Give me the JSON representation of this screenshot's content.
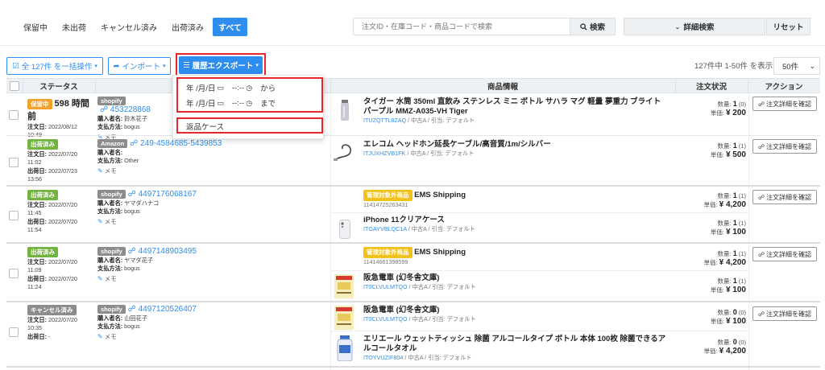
{
  "filters": {
    "tabs": [
      {
        "label": "保留中",
        "active": false
      },
      {
        "label": "未出荷",
        "active": false
      },
      {
        "label": "キャンセル済み",
        "active": false
      },
      {
        "label": "出荷済み",
        "active": false
      },
      {
        "label": "すべて",
        "active": true
      }
    ],
    "search_placeholder": "注文ID・在庫コード・商品コードで検索",
    "search_button": "検索",
    "advanced_search": "詳細検索",
    "reset": "リセット"
  },
  "toolbar": {
    "bulk_action": "全 127件 を一括操作",
    "import": "インポート",
    "export": "履歴エクスポート",
    "page_info": "127件中 1-50件 を表示",
    "page_size": "50件"
  },
  "export_dropdown": {
    "date_placeholder": "年 /月/日",
    "time_placeholder": "--:--",
    "from_label": "から",
    "to_label": "まで",
    "returns_item": "返品ケース"
  },
  "table": {
    "headers": {
      "status": "ステータス",
      "product": "商品情報",
      "order_status": "注文状況",
      "action": "アクション"
    },
    "detail_button": "注文詳細を確認",
    "memo_label": "メモ",
    "labels": {
      "order_date": "注文日:",
      "ship_date": "出荷日:",
      "buyer": "購入者名:",
      "payment": "支払方法:",
      "qty": "数量:",
      "unit_price": "単価:"
    },
    "rows": [
      {
        "status_badge": "保留中",
        "status_color": "#f3a12d",
        "hours": "598 時間前",
        "order_date": "2022/08/12",
        "order_time": "10:49",
        "ship_date": "-",
        "ship_time": "",
        "channel": "shopify",
        "order_id": "453228868",
        "buyer": "鈴木花子",
        "payment": "bogus",
        "items": [
          {
            "name": "タイガー 水筒 350ml 直飲み ステンレス ミニ ボトル サハラ マグ 軽量 夢重力 ブライトパープル MMZ-A035-VH Tiger",
            "badge": "",
            "sku": "ITUZQTTL8ZAQ",
            "meta": "/ 中古A / 引当: デフォルト",
            "qty": "1",
            "qty_note": "(0)",
            "price": "¥ 200",
            "thumb": "bottle"
          }
        ]
      },
      {
        "status_badge": "出荷済み",
        "status_color": "#72b43f",
        "hours": "",
        "order_date": "2022/07/20",
        "order_time": "11:02",
        "ship_date": "2022/07/23",
        "ship_time": "13:56",
        "channel": "Amazon",
        "order_id": "249-4584685-5439853",
        "buyer": "",
        "payment": "Other",
        "items": [
          {
            "name": "エレコム ヘッドホン延長ケーブル/高音質/1m/シルバー",
            "badge": "",
            "sku": "ITJUXHZVB1FK",
            "meta": "/ 中古A / 引当: デフォルト",
            "qty": "1",
            "qty_note": "(1)",
            "price": "¥ 500",
            "thumb": "cable"
          }
        ]
      },
      {
        "status_badge": "出荷済み",
        "status_color": "#72b43f",
        "hours": "",
        "order_date": "2022/07/20",
        "order_time": "11:45",
        "ship_date": "2022/07/20",
        "ship_time": "11:54",
        "channel": "shopify",
        "order_id": "4497176068167",
        "buyer": "ヤマダハナコ",
        "payment": "bogus",
        "items": [
          {
            "name": "EMS Shipping",
            "badge": "管理対象外商品",
            "sku": "",
            "sku_plain": "11414725263431",
            "meta": "",
            "qty": "1",
            "qty_note": "(1)",
            "price": "¥ 4,200",
            "thumb": ""
          },
          {
            "name": "iPhone 11クリアケース",
            "badge": "",
            "sku": "ITGAYVBLQC1A",
            "meta": "/ 中古A / 引当: デフォルト",
            "qty": "1",
            "qty_note": "(1)",
            "price": "¥ 100",
            "thumb": "phone"
          }
        ]
      },
      {
        "status_badge": "出荷済み",
        "status_color": "#72b43f",
        "hours": "",
        "order_date": "2022/07/20",
        "order_time": "11:09",
        "ship_date": "2022/07/20",
        "ship_time": "11:24",
        "channel": "shopify",
        "order_id": "4497148903495",
        "buyer": "ヤマダ花子",
        "payment": "bogus",
        "items": [
          {
            "name": "EMS Shipping",
            "badge": "管理対象外商品",
            "sku": "",
            "sku_plain": "11414661398599",
            "meta": "",
            "qty": "1",
            "qty_note": "(1)",
            "price": "¥ 4,200",
            "thumb": ""
          },
          {
            "name": "阪急電車 (幻冬舎文庫)",
            "badge": "",
            "sku": "IT0CLVULMTQO",
            "meta": "/ 中古A / 引当: デフォルト",
            "qty": "1",
            "qty_note": "(1)",
            "price": "¥ 100",
            "thumb": "book"
          }
        ]
      },
      {
        "status_badge": "キャンセル済み",
        "status_color": "#8c8c8c",
        "hours": "",
        "order_date": "2022/07/20",
        "order_time": "10:35",
        "ship_date": "-",
        "ship_time": "",
        "channel": "shopify",
        "order_id": "4497120526407",
        "buyer": "山田花子",
        "payment": "bogus",
        "items": [
          {
            "name": "阪急電車 (幻冬舎文庫)",
            "badge": "",
            "sku": "IT0CLVULMTQO",
            "meta": "/ 中古A / 引当: デフォルト",
            "qty": "0",
            "qty_note": "(0)",
            "price": "¥ 100",
            "thumb": "book"
          },
          {
            "name": "エリエール ウェットティッシュ 除菌 アルコールタイプ ボトル 本体 100枚 除菌できるアルコールタオル",
            "badge": "",
            "sku": "ITOYVUZIF804",
            "meta": "/ 中古A / 引当: デフォルト",
            "qty": "0",
            "qty_note": "(0)",
            "price": "¥ 4,200",
            "thumb": "tissue"
          }
        ]
      }
    ]
  }
}
